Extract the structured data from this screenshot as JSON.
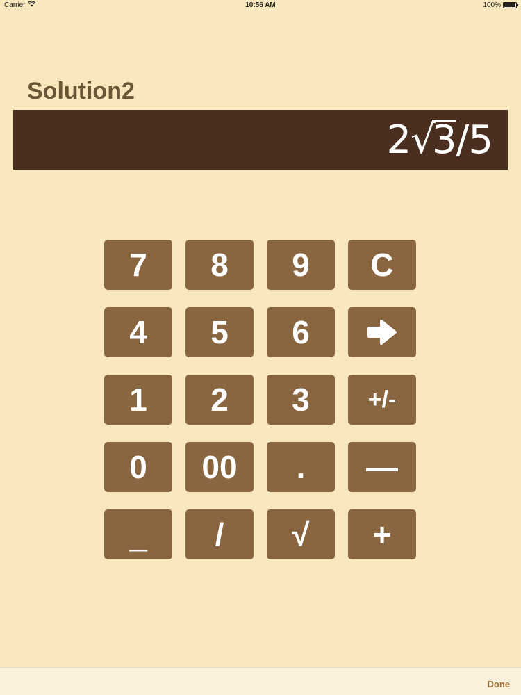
{
  "status_bar": {
    "carrier": "Carrier",
    "time": "10:56 AM",
    "battery": "100%"
  },
  "title": "Solution2",
  "display": {
    "coefficient": "2",
    "radical_sign": "√",
    "radicand": "3",
    "tail": "/5"
  },
  "keypad": {
    "keys": [
      {
        "label": "7"
      },
      {
        "label": "8"
      },
      {
        "label": "9"
      },
      {
        "label": "C"
      },
      {
        "label": "4"
      },
      {
        "label": "5"
      },
      {
        "label": "6"
      },
      {
        "icon": "arrow-right-icon"
      },
      {
        "label": "1"
      },
      {
        "label": "2"
      },
      {
        "label": "3"
      },
      {
        "label": "+/-"
      },
      {
        "label": "0"
      },
      {
        "label": "00"
      },
      {
        "label": "."
      },
      {
        "label": "—"
      },
      {
        "label": "_"
      },
      {
        "label": "/"
      },
      {
        "label": "√"
      },
      {
        "label": "+"
      }
    ]
  },
  "bottom_bar": {
    "done_label": "Done"
  },
  "colors": {
    "background": "#f9e7bd",
    "display_bg": "#4a2e1f",
    "key_bg": "#8a6640",
    "title": "#6b5535",
    "done": "#a0743c"
  }
}
